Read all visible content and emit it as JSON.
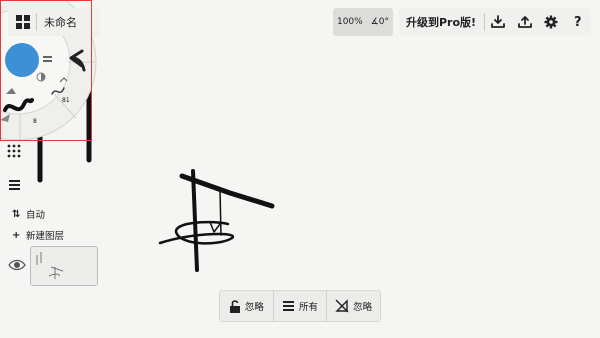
{
  "document": {
    "title": "未命名"
  },
  "brush_wheel": {
    "color": "#3d8fd6",
    "size_label": "8",
    "opacity_label": "81"
  },
  "sidebar": {
    "auto_label": "自动",
    "new_layer_label": "新建图层"
  },
  "view": {
    "zoom": "100%",
    "rotation": "0°"
  },
  "toolbar": {
    "upgrade_label": "升级到Pro版!",
    "icons": [
      "download-icon",
      "upload-icon",
      "gear-icon",
      "help-icon"
    ],
    "help_glyph": "?"
  },
  "bottom_bar": {
    "items": [
      {
        "icon": "unlock-icon",
        "label": "忽略"
      },
      {
        "icon": "layers-stack-icon",
        "label": "所有"
      },
      {
        "icon": "ruler-slash-icon",
        "label": "忽略"
      }
    ]
  },
  "colors": {
    "accent": "#3d8fd6",
    "selection": "#e53935",
    "ink": "#111111"
  }
}
